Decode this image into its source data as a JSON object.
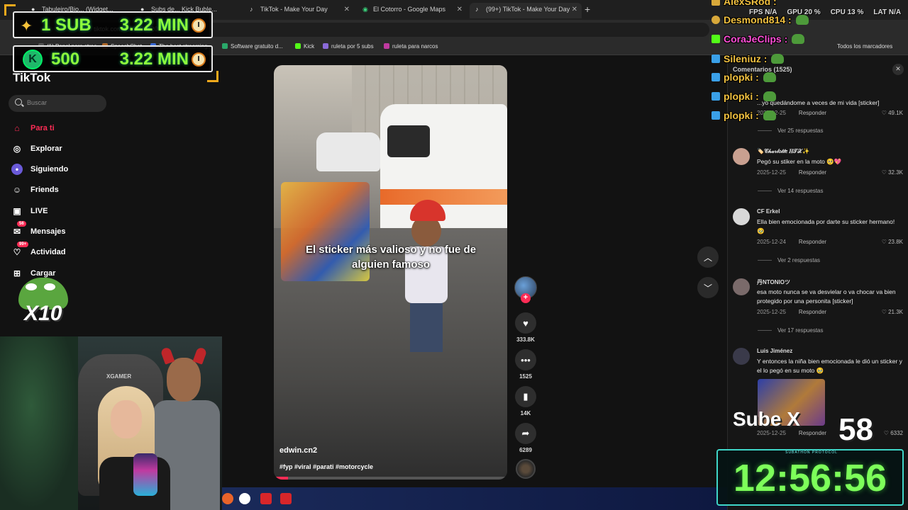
{
  "browser": {
    "tabs": [
      {
        "label": "Tabuleiro/Bio... (Widget...",
        "active": false
      },
      {
        "label": "Subs de... Kick Buble...",
        "active": false
      },
      {
        "label": "TikTok - Make Your Day",
        "active": false
      },
      {
        "label": "El Cotorro - Google Maps",
        "active": false
      },
      {
        "label": "(99+) TikTok - Make Your Day",
        "active": true
      }
    ],
    "url": "tiktok.com/...5948962055",
    "bookmarks": [
      {
        "label": "(1) Panel para strea...",
        "color": "#555555"
      },
      {
        "label": "SpeechChat",
        "color": "#b26a2a"
      },
      {
        "label": "The best streaming...",
        "color": "#3a6ad8"
      },
      {
        "label": "Software gratuito d...",
        "color": "#2aa86a"
      },
      {
        "label": "Kick",
        "color": "#53fc18"
      },
      {
        "label": "ruleta por 5 subs",
        "color": "#8a6ad8"
      },
      {
        "label": "ruleta para narcos",
        "color": "#c03aa0"
      }
    ],
    "all_bookmarks": "Todos los marcadores"
  },
  "tiktok": {
    "logo": "TikTok",
    "search_placeholder": "Buscar",
    "nav": [
      {
        "label": "Para ti",
        "icon": "home-icon",
        "badge": ""
      },
      {
        "label": "Explorar",
        "icon": "compass-icon",
        "badge": ""
      },
      {
        "label": "Siguiendo",
        "icon": "following-icon",
        "badge": ""
      },
      {
        "label": "Friends",
        "icon": "friends-icon",
        "badge": ""
      },
      {
        "label": "LIVE",
        "icon": "live-icon",
        "badge": ""
      },
      {
        "label": "Mensajes",
        "icon": "messages-icon",
        "badge": "56"
      },
      {
        "label": "Actividad",
        "icon": "activity-icon",
        "badge": "99+"
      },
      {
        "label": "Cargar",
        "icon": "upload-icon",
        "badge": ""
      }
    ]
  },
  "video": {
    "caption": "El sticker más valioso y no fue de alguien famoso",
    "author": "edwin.cn2",
    "tags": "#fyp #viral #parati #motorcycle",
    "progress": 0.06,
    "likes": "333.8K",
    "comments": "1525",
    "saves": "14K",
    "shares": "6289"
  },
  "comments": {
    "header": "Comentarios (1525)",
    "top_partial": {
      "text": "...yo quedándome a veces de mi vida [sticker]",
      "date": "2025-12-25",
      "reply": "Responder",
      "likes": "49.1K"
    },
    "items": [
      {
        "more": "Ver 25 respuestas"
      },
      {
        "name": "🏷️𝒞𝒽𝒶𝓇𝓁𝑜𝓉𝓉𝑒 𝐻𝒯𝒳✨",
        "text": "Pegó su stiker en la moto 🥺💖",
        "date": "2025-12-25",
        "reply": "Responder",
        "likes": "32.3K",
        "avatar": "#c9a090",
        "more": "Ver 14 respuestas"
      },
      {
        "name": "CF Erkel",
        "text": "Ella bien emocionada por darte su sticker hermano! 🥹",
        "date": "2025-12-24",
        "reply": "Responder",
        "likes": "23.8K",
        "avatar": "#d8d8d8",
        "more": "Ver 2 respuestas"
      },
      {
        "name": "丹NTONIOツ",
        "text": "esa moto nunca se va desvielar o va chocar va bien protegido por una personita [sticker]",
        "date": "2025-12-25",
        "reply": "Responder",
        "likes": "21.3K",
        "avatar": "#7a6a6a",
        "more": "Ver 17 respuestas"
      },
      {
        "name": "Luis Jiménez",
        "text": "Y entonces la niña bien emocionada le dió un sticker y el lo pegó en su moto 🥹",
        "date": "2025-12-25",
        "reply": "Responder",
        "likes": "6332",
        "avatar": "#3a3a4a"
      }
    ]
  },
  "overlay": {
    "sub_label": "1 SUB",
    "sub_time": "3.22 MIN",
    "gem_label": "500",
    "gem_time": "3.22 MIN",
    "pepe_multiplier": "X10",
    "chat": [
      {
        "user": "AlexSRod",
        "color": "#f0c040"
      },
      {
        "user": "Desmond814",
        "color": "#f0c040"
      },
      {
        "user": "CoraJeClips",
        "color": "#ff4fd8"
      },
      {
        "user": "Sileniuz",
        "color": "#f0c040"
      },
      {
        "user": "plopki",
        "color": "#f0c040"
      },
      {
        "user": "plopki",
        "color": "#f0c040"
      },
      {
        "user": "plopki",
        "color": "#f0c040"
      }
    ],
    "stats": {
      "fps": "FPS N/A",
      "gpu": "GPU 20 %",
      "cpu": "CPU 13 %",
      "lat": "LAT N/A"
    },
    "sube_label": "Sube X",
    "sube_value": "58",
    "timer_label": "SUBATHON PROTOCOL",
    "timer": "12:56:56",
    "cam_chair_brand": "XGAMER"
  }
}
